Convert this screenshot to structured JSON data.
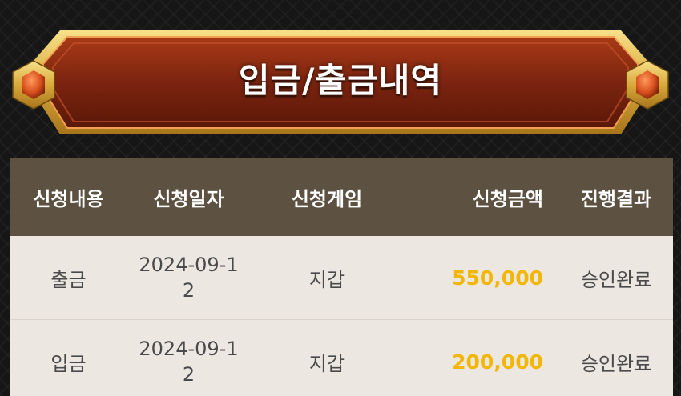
{
  "header": {
    "title": "입금/출금내역"
  },
  "table": {
    "columns": [
      "신청내용",
      "신청일자",
      "신청게임",
      "신청금액",
      "진행결과"
    ],
    "rows": [
      {
        "type": "출금",
        "date": "2024-09-12",
        "game": "지갑",
        "amount": "550,000",
        "result": "승인완료"
      },
      {
        "type": "입금",
        "date": "2024-09-12",
        "game": "지갑",
        "amount": "200,000",
        "result": "승인완료"
      }
    ]
  },
  "colors": {
    "amount": "#f2b705",
    "header_bg": "#5d5142",
    "row_bg": "#ece7e1",
    "banner": "#8a2a10"
  }
}
